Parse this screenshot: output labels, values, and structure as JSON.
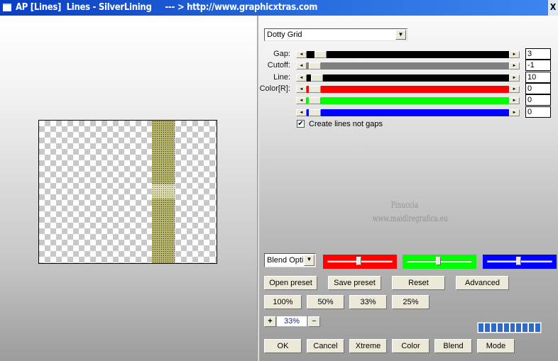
{
  "window": {
    "title": "AP [Lines]  Lines - SilverLining     --- > http://www.graphicxtras.com",
    "close_label": "X"
  },
  "preset_combo": {
    "value": "Dotty Grid"
  },
  "sliders": [
    {
      "label": "Gap:",
      "value": "3",
      "track_color": "#000000",
      "position_pct": 3
    },
    {
      "label": "Cutoff:",
      "value": "-1",
      "track_color": "#808080",
      "position_pct": 0
    },
    {
      "label": "Line:",
      "value": "10",
      "track_color": "#000000",
      "position_pct": 1
    },
    {
      "label": "Color[R]:",
      "value": "0",
      "track_color": "#ff0000",
      "position_pct": 0
    },
    {
      "label": "",
      "value": "0",
      "track_color": "#00ff00",
      "position_pct": 0
    },
    {
      "label": "",
      "value": "0",
      "track_color": "#0000ff",
      "position_pct": 0
    }
  ],
  "checkbox": {
    "label": "Create lines not gaps",
    "checked": true
  },
  "watermark": {
    "line1": "Pinuccia",
    "line2": "www.maidiregrafica.eu"
  },
  "blend_combo": {
    "value": "Blend Opti"
  },
  "blend_sliders": [
    {
      "color": "#ff0000",
      "position_pct": 50
    },
    {
      "color": "#00ff00",
      "position_pct": 50
    },
    {
      "color": "#0000ff",
      "position_pct": 50
    }
  ],
  "buttons": {
    "open_preset": "Open preset",
    "save_preset": "Save preset",
    "reset": "Reset",
    "advanced": "Advanced",
    "z100": "100%",
    "z50": "50%",
    "z33": "33%",
    "z25": "25%",
    "plus": "+",
    "minus": "−",
    "ok": "OK",
    "cancel": "Cancel",
    "xtreme": "Xtreme",
    "color": "Color",
    "blend": "Blend",
    "mode": "Mode"
  },
  "zoom": {
    "value": "33%"
  },
  "progress": {
    "segments": 10,
    "filled": 10
  }
}
